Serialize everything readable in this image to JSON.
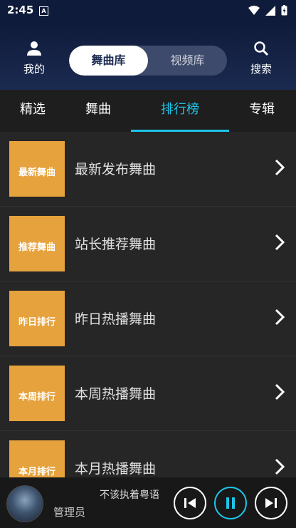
{
  "status": {
    "time": "2:45",
    "app_badge": "A"
  },
  "header": {
    "left_label": "我的",
    "right_label": "搜索",
    "segments": [
      "舞曲库",
      "视频库"
    ],
    "active_segment": 0
  },
  "tabs": {
    "items": [
      "精选",
      "舞曲",
      "排行榜",
      "专辑"
    ],
    "active": 2
  },
  "list": {
    "items": [
      {
        "thumb": "最新舞曲",
        "title": "最新发布舞曲"
      },
      {
        "thumb": "推荐舞曲",
        "title": "站长推荐舞曲"
      },
      {
        "thumb": "昨日排行",
        "title": "昨日热播舞曲"
      },
      {
        "thumb": "本周排行",
        "title": "本周热播舞曲"
      },
      {
        "thumb": "本月排行",
        "title": "本月热播舞曲"
      }
    ]
  },
  "player": {
    "song": "不该执着粤语",
    "artist": "管理员"
  },
  "colors": {
    "accent": "#1ec4e6",
    "thumb_bg": "#e6a23c",
    "header_bg": "#0f1b3a"
  }
}
